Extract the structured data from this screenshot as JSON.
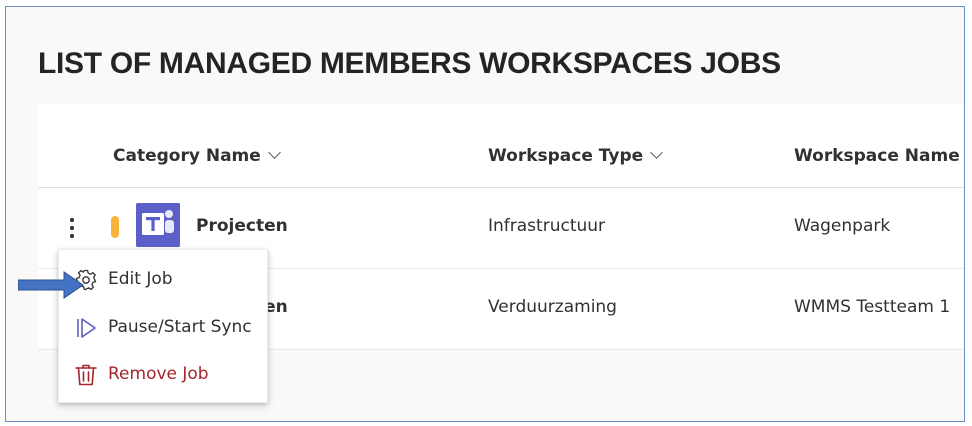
{
  "page": {
    "title": "LIST OF MANAGED MEMBERS WORKSPACES JOBS"
  },
  "table": {
    "columns": [
      {
        "label": "Category Name"
      },
      {
        "label": "Workspace Type"
      },
      {
        "label": "Workspace Name"
      }
    ],
    "rows": [
      {
        "category": "Projecten",
        "workspace_type": "Infrastructuur",
        "workspace_name": "Wagenpark"
      },
      {
        "category": "Projecten",
        "workspace_type": "Verduurzaming",
        "workspace_name": "WMMS Testteam 1"
      }
    ]
  },
  "context_menu": {
    "items": [
      {
        "label": "Edit Job",
        "icon": "gear-icon"
      },
      {
        "label": "Pause/Start Sync",
        "icon": "pause-play-icon"
      },
      {
        "label": "Remove Job",
        "icon": "trash-icon"
      }
    ]
  },
  "colors": {
    "status_pill": "#f8b33a",
    "teams_brand": "#5b5fc7",
    "danger": "#a4262c",
    "arrow": "#4472c4",
    "border": "#6b8fc4"
  }
}
